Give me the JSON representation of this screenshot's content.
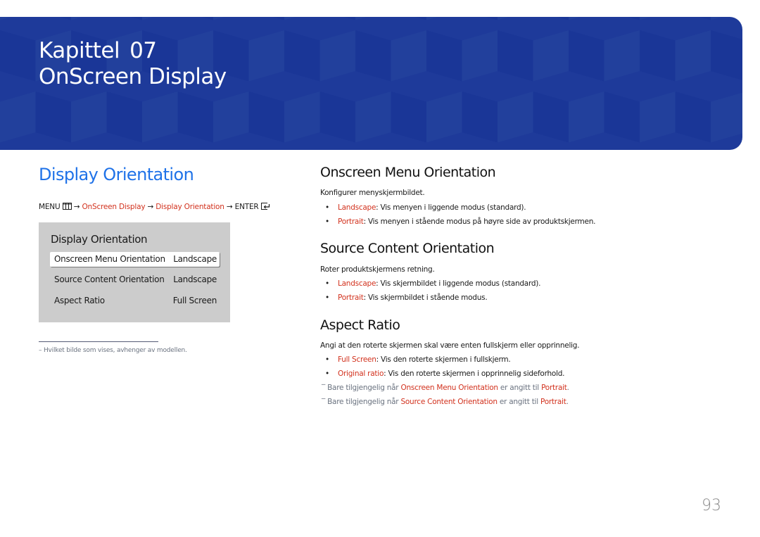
{
  "banner": {
    "chapter_label": "Kapittel",
    "chapter_number": "07",
    "chapter_title": "OnScreen Display",
    "colors": {
      "background": "#1e3a9a",
      "light_face": "#22409c",
      "dark_face": "#1a3697"
    }
  },
  "left": {
    "section_title": "Display Orientation",
    "breadcrumb": {
      "menu": "MENU",
      "menu_icon": "menu-grid-icon",
      "arrow": "→",
      "step1": "OnScreen Display",
      "step2": "Display Orientation",
      "enter": "ENTER",
      "enter_icon": "enter-icon"
    },
    "osd_menu": {
      "title": "Display Orientation",
      "items": [
        {
          "label": "Onscreen Menu Orientation",
          "value": "Landscape",
          "selected": true
        },
        {
          "label": "Source Content Orientation",
          "value": "Landscape",
          "selected": false
        },
        {
          "label": "Aspect Ratio",
          "value": "Full Screen",
          "selected": false
        }
      ]
    },
    "footnote": "–  Hvilket bilde som vises, avhenger av modellen."
  },
  "right": {
    "sections": [
      {
        "heading": "Onscreen Menu Orientation",
        "description": "Konfigurer menyskjermbildet.",
        "bullets": [
          {
            "term": "Landscape",
            "text": ": Vis menyen i liggende modus (standard)."
          },
          {
            "term": "Portrait",
            "text": ": Vis menyen i stående modus på høyre side av produktskjermen."
          }
        ]
      },
      {
        "heading": "Source Content Orientation",
        "description": "Roter produktskjermens retning.",
        "bullets": [
          {
            "term": "Landscape",
            "text": ": Vis skjermbildet i liggende modus (standard)."
          },
          {
            "term": "Portrait",
            "text": ": Vis skjermbildet i stående modus."
          }
        ]
      },
      {
        "heading": "Aspect Ratio",
        "description": "Angi at den roterte skjermen skal være enten fullskjerm eller opprinnelig.",
        "bullets": [
          {
            "term": "Full Screen",
            "text": ": Vis den roterte skjermen i fullskjerm."
          },
          {
            "term": "Original ratio",
            "text": ": Vis den roterte skjermen i opprinnelig sideforhold."
          }
        ],
        "notes": [
          {
            "prefix": "‾ Bare tilgjengelig når ",
            "term": "Onscreen Menu Orientation",
            "mid": " er angitt til ",
            "value": "Portrait",
            "end": "."
          },
          {
            "prefix": "‾ Bare tilgjengelig når ",
            "term": "Source Content Orientation",
            "mid": " er angitt til ",
            "value": "Portrait",
            "end": "."
          }
        ]
      }
    ]
  },
  "page_number": "93",
  "colors": {
    "accent_blue": "#1f72e8",
    "accent_red": "#d2321e",
    "osd_bg": "#cccccc"
  }
}
